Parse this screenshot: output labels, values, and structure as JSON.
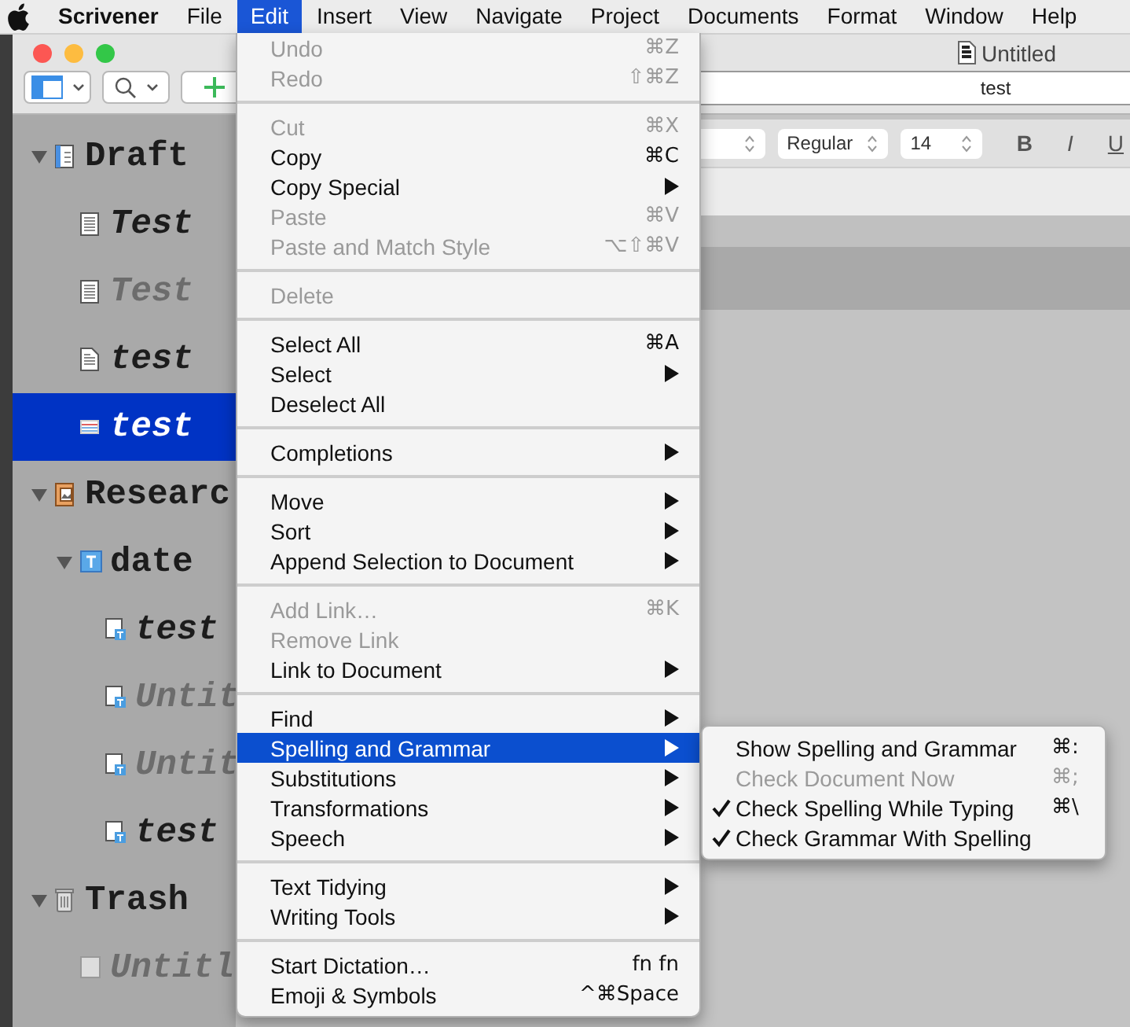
{
  "menu_bar": {
    "items": [
      {
        "label": "Scrivener",
        "kind": "app",
        "selected": false
      },
      {
        "label": "File",
        "kind": "menu",
        "selected": false
      },
      {
        "label": "Edit",
        "kind": "menu",
        "selected": true
      },
      {
        "label": "Insert",
        "kind": "menu",
        "selected": false
      },
      {
        "label": "View",
        "kind": "menu",
        "selected": false
      },
      {
        "label": "Navigate",
        "kind": "menu",
        "selected": false
      },
      {
        "label": "Project",
        "kind": "menu",
        "selected": false
      },
      {
        "label": "Documents",
        "kind": "menu",
        "selected": false
      },
      {
        "label": "Format",
        "kind": "menu",
        "selected": false
      },
      {
        "label": "Window",
        "kind": "menu",
        "selected": false
      },
      {
        "label": "Help",
        "kind": "menu",
        "selected": false
      }
    ]
  },
  "window": {
    "title": "Untitled",
    "header": "test"
  },
  "binder": {
    "items": [
      {
        "label": "Draft",
        "kind": "draft",
        "expanded": true,
        "dimmed": false,
        "selected": false,
        "children": [
          {
            "label": "Test",
            "kind": "lined-page",
            "dimmed": false,
            "selected": false
          },
          {
            "label": "Test",
            "kind": "lined-page",
            "dimmed": true,
            "selected": false
          },
          {
            "label": "test",
            "kind": "page",
            "dimmed": false,
            "selected": false
          },
          {
            "label": "test",
            "kind": "card",
            "dimmed": false,
            "selected": true
          }
        ]
      },
      {
        "label": "Researc",
        "kind": "research",
        "expanded": true,
        "dimmed": false,
        "selected": false,
        "children": [
          {
            "label": "date",
            "kind": "text-folder",
            "expanded": true,
            "dimmed": false,
            "selected": false,
            "children": [
              {
                "label": "test",
                "kind": "text-page",
                "dimmed": false,
                "selected": false
              },
              {
                "label": "Untit",
                "kind": "text-page",
                "dimmed": true,
                "selected": false
              },
              {
                "label": "Untit",
                "kind": "text-page",
                "dimmed": true,
                "selected": false
              },
              {
                "label": "test",
                "kind": "text-page",
                "dimmed": false,
                "selected": false
              }
            ]
          }
        ]
      },
      {
        "label": "Trash",
        "kind": "trash",
        "expanded": true,
        "dimmed": false,
        "selected": false,
        "children": [
          {
            "label": "Untitl",
            "kind": "blank",
            "dimmed": true,
            "selected": false
          }
        ]
      }
    ]
  },
  "format_bar": {
    "style": "Regular",
    "size": "14",
    "buttons": [
      {
        "label": "B",
        "kind": "bold"
      },
      {
        "label": "I",
        "kind": "italic"
      },
      {
        "label": "U",
        "kind": "underline"
      }
    ]
  },
  "edit_menu": {
    "sections": [
      {
        "items": [
          {
            "label": "Undo",
            "shortcut": "⌘Z",
            "disabled": true,
            "submenu": false,
            "selected": false
          },
          {
            "label": "Redo",
            "shortcut": "⇧⌘Z",
            "disabled": true,
            "submenu": false,
            "selected": false
          }
        ]
      },
      {
        "items": [
          {
            "label": "Cut",
            "shortcut": "⌘X",
            "disabled": true,
            "submenu": false,
            "selected": false
          },
          {
            "label": "Copy",
            "shortcut": "⌘C",
            "disabled": false,
            "submenu": false,
            "selected": false
          },
          {
            "label": "Copy Special",
            "disabled": false,
            "submenu": true,
            "selected": false
          },
          {
            "label": "Paste",
            "shortcut": "⌘V",
            "disabled": true,
            "submenu": false,
            "selected": false
          },
          {
            "label": "Paste and Match Style",
            "shortcut": "⌥⇧⌘V",
            "disabled": true,
            "submenu": false,
            "selected": false
          }
        ]
      },
      {
        "items": [
          {
            "label": "Delete",
            "disabled": true,
            "submenu": false,
            "selected": false
          }
        ]
      },
      {
        "items": [
          {
            "label": "Select All",
            "shortcut": "⌘A",
            "disabled": false,
            "submenu": false,
            "selected": false
          },
          {
            "label": "Select",
            "disabled": false,
            "submenu": true,
            "selected": false
          },
          {
            "label": "Deselect All",
            "disabled": false,
            "submenu": false,
            "selected": false
          }
        ]
      },
      {
        "items": [
          {
            "label": "Completions",
            "disabled": false,
            "submenu": true,
            "selected": false
          }
        ]
      },
      {
        "items": [
          {
            "label": "Move",
            "disabled": false,
            "submenu": true,
            "selected": false
          },
          {
            "label": "Sort",
            "disabled": false,
            "submenu": true,
            "selected": false
          },
          {
            "label": "Append Selection to Document",
            "disabled": false,
            "submenu": true,
            "selected": false
          }
        ]
      },
      {
        "items": [
          {
            "label": "Add Link…",
            "shortcut": "⌘K",
            "disabled": true,
            "submenu": false,
            "selected": false
          },
          {
            "label": "Remove Link",
            "disabled": true,
            "submenu": false,
            "selected": false
          },
          {
            "label": "Link to Document",
            "disabled": false,
            "submenu": true,
            "selected": false
          }
        ]
      },
      {
        "items": [
          {
            "label": "Find",
            "disabled": false,
            "submenu": true,
            "selected": false
          },
          {
            "label": "Spelling and Grammar",
            "disabled": false,
            "submenu": true,
            "selected": true
          },
          {
            "label": "Substitutions",
            "disabled": false,
            "submenu": true,
            "selected": false
          },
          {
            "label": "Transformations",
            "disabled": false,
            "submenu": true,
            "selected": false
          },
          {
            "label": "Speech",
            "disabled": false,
            "submenu": true,
            "selected": false
          }
        ]
      },
      {
        "items": [
          {
            "label": "Text Tidying",
            "disabled": false,
            "submenu": true,
            "selected": false
          },
          {
            "label": "Writing Tools",
            "disabled": false,
            "submenu": true,
            "selected": false
          }
        ]
      },
      {
        "items": [
          {
            "label": "Start Dictation…",
            "shortcut": "fn fn",
            "disabled": false,
            "submenu": false,
            "selected": false
          },
          {
            "label": "Emoji & Symbols",
            "shortcut": "^⌘Space",
            "disabled": false,
            "submenu": false,
            "selected": false
          }
        ]
      }
    ]
  },
  "spelling_submenu": {
    "items": [
      {
        "label": "Show Spelling and Grammar",
        "shortcut": "⌘:",
        "disabled": false,
        "checked": false
      },
      {
        "label": "Check Document Now",
        "shortcut": "⌘;",
        "disabled": true,
        "checked": false
      },
      {
        "label": "Check Spelling While Typing",
        "shortcut": "⌘\\",
        "disabled": false,
        "checked": true
      },
      {
        "label": "Check Grammar With Spelling",
        "disabled": false,
        "checked": true
      }
    ]
  }
}
